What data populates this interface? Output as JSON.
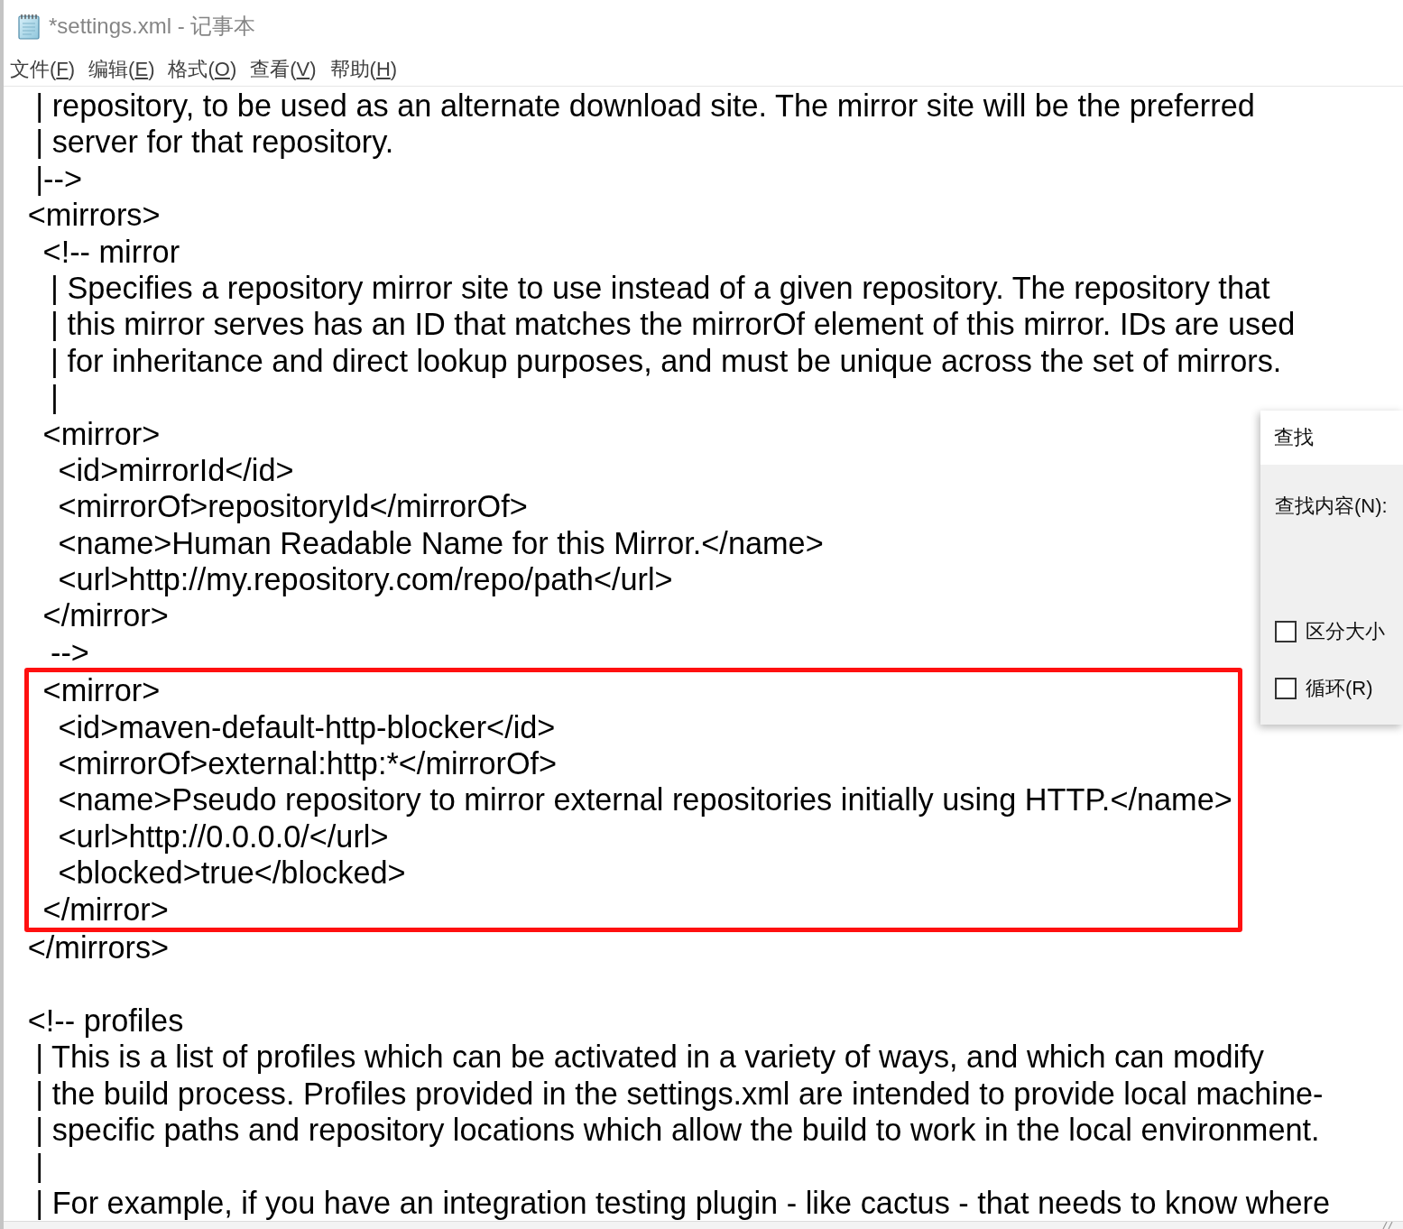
{
  "window": {
    "title": "*settings.xml - 记事本"
  },
  "menu_bar": [
    {
      "before": "文件(",
      "access_key": "F",
      "after": ")"
    },
    {
      "before": "编辑(",
      "access_key": "E",
      "after": ")"
    },
    {
      "before": "格式(",
      "access_key": "O",
      "after": ")"
    },
    {
      "before": "查看(",
      "access_key": "V",
      "after": ")"
    },
    {
      "before": "帮助(",
      "access_key": "H",
      "after": ")"
    }
  ],
  "editor": {
    "blocks": [
      {
        "highlighted": false,
        "lines": [
          {
            "kind": "text",
            "text": "   | repository, to be used as an alternate download site. The mirror site will be the preferred"
          },
          {
            "kind": "text",
            "text": "   | server for that repository."
          },
          {
            "kind": "text",
            "text": "   |-->"
          },
          {
            "kind": "text",
            "text": "  <mirrors>"
          },
          {
            "kind": "text",
            "text": "    <!-- mirror"
          },
          {
            "kind": "text",
            "text": "     | Specifies a repository mirror site to use instead of a given repository. The repository that"
          },
          {
            "kind": "text",
            "text": "     | this mirror serves has an ID that matches the mirrorOf element of this mirror. IDs are used"
          },
          {
            "kind": "text",
            "text": "     | for inheritance and direct lookup purposes, and must be unique across the set of mirrors."
          },
          {
            "kind": "text",
            "text": "     |"
          },
          {
            "kind": "text",
            "text": "    <mirror>"
          },
          {
            "kind": "text",
            "text": "      <id>mirrorId</id>"
          },
          {
            "kind": "text",
            "text": "      <mirrorOf>repositoryId</mirrorOf>"
          },
          {
            "kind": "text",
            "text": "      <name>Human Readable Name for this Mirror.</name>"
          },
          {
            "kind": "text",
            "text": "      <url>http://my.repository.com/repo/path</url>"
          },
          {
            "kind": "text",
            "text": "    </mirror>"
          },
          {
            "kind": "text",
            "text": "     -->"
          }
        ]
      },
      {
        "highlighted": true,
        "lines": [
          {
            "kind": "text",
            "text": "    <mirror>"
          },
          {
            "kind": "text",
            "text": "      <id>maven-default-http-blocker</id>"
          },
          {
            "kind": "text",
            "text": "      <mirrorOf>external:http:*</mirrorOf>"
          },
          {
            "kind": "text",
            "text": "      <name>Pseudo repository to mirror external repositories initially using HTTP.</name>"
          },
          {
            "kind": "text",
            "text": "      <url>http://0.0.0.0/</url>"
          },
          {
            "kind": "text",
            "text": "      <blocked>true</blocked>"
          },
          {
            "kind": "text",
            "text": "    </mirror>"
          }
        ]
      },
      {
        "highlighted": false,
        "lines": [
          {
            "kind": "text",
            "text": "  </mirrors>"
          },
          {
            "kind": "blank"
          },
          {
            "kind": "text",
            "text": "  <!-- profiles"
          },
          {
            "kind": "text",
            "text": "   | This is a list of profiles which can be activated in a variety of ways, and which can modify"
          },
          {
            "kind": "text",
            "text": "   | the build process. Profiles provided in the settings.xml are intended to provide local machine-"
          },
          {
            "kind": "text",
            "text": "   | specific paths and repository locations which allow the build to work in the local environment."
          },
          {
            "kind": "text",
            "text": "   |"
          },
          {
            "kind": "text",
            "text": "   | For example, if you have an integration testing plugin - like cactus - that needs to know where"
          }
        ]
      }
    ]
  },
  "find_dialog": {
    "title": "查找",
    "find_label": "查找内容(N):",
    "options": [
      {
        "label": "区分大小",
        "checked": false
      },
      {
        "label": "循环(R)",
        "checked": false
      }
    ]
  }
}
